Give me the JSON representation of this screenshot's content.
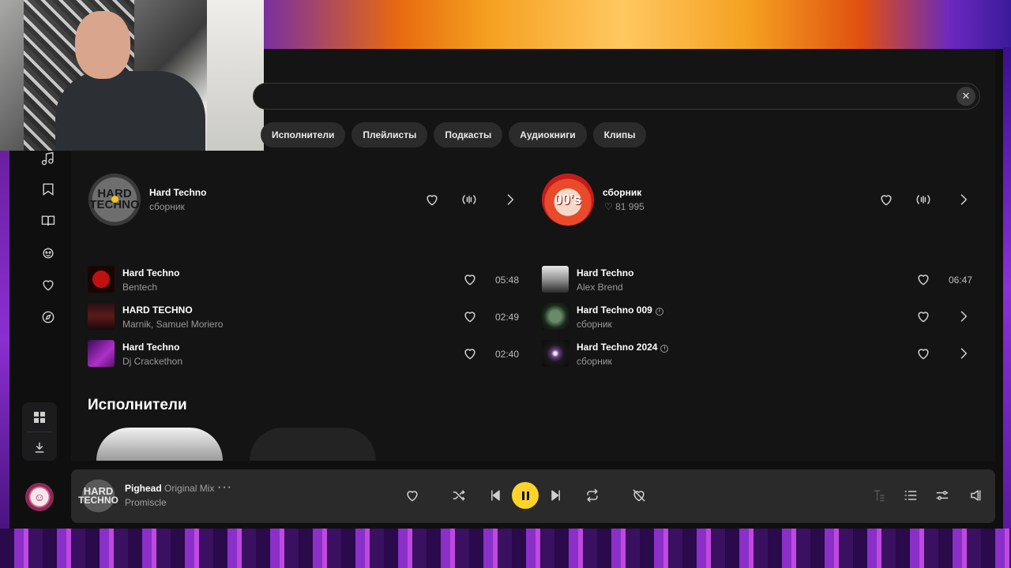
{
  "search": {
    "placeholder": "",
    "value": ""
  },
  "filters": [
    "Исполнители",
    "Плейлисты",
    "Подкасты",
    "Аудиокниги",
    "Клипы"
  ],
  "top_results": [
    {
      "title": "Hard Techno",
      "subtitle": "сборник",
      "cover_text": [
        "HARD",
        "TECHNO"
      ]
    },
    {
      "title": "сборник",
      "subtitle": "81 995",
      "cover_text": "00's"
    }
  ],
  "tracks_left": [
    {
      "title": "Hard Techno",
      "artist": "Bentech",
      "duration": "05:48"
    },
    {
      "title": "HARD TECHNO",
      "artist": "Marnik, Samuel Moriero",
      "duration": "02:49"
    },
    {
      "title": "Hard Techno",
      "artist": "Dj Crackethon",
      "duration": "02:40"
    }
  ],
  "tracks_right": [
    {
      "title": "Hard Techno",
      "artist": "Alex Brend",
      "duration": "06:47"
    },
    {
      "title": "Hard Techno 009",
      "artist": "сборник",
      "duration": ""
    },
    {
      "title": "Hard Techno 2024",
      "artist": "сборник",
      "duration": ""
    }
  ],
  "sections": {
    "artists_title": "Исполнители"
  },
  "player": {
    "title": "Pighead",
    "version": "Original Mix",
    "artist": "Promiscle",
    "more": "···",
    "cover_text": [
      "HARD",
      "TECHNO"
    ]
  },
  "colors": {
    "accent": "#fed42b",
    "panel": "#141414",
    "player_bg": "#2a2a2b"
  }
}
